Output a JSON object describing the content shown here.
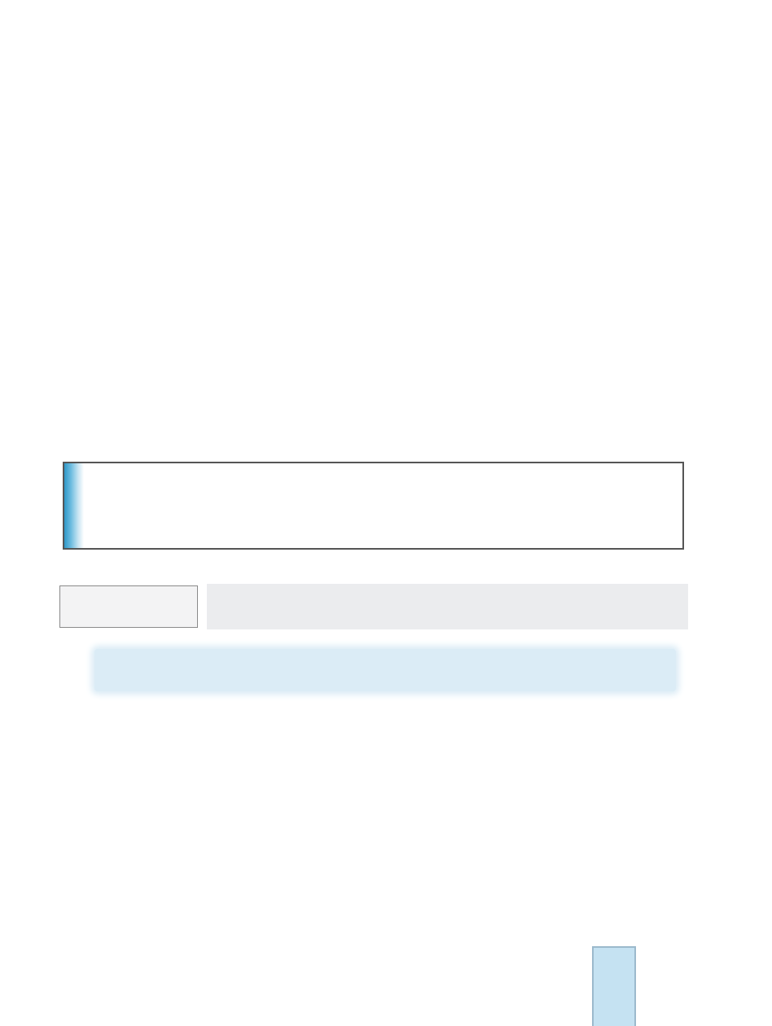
{
  "colors": {
    "callout_border": "#555555",
    "callout_accent": "#2f98c8",
    "label_box_fill": "#f3f3f4",
    "grey_band": "#ebecee",
    "blue_banner": "#dbecf6",
    "page_tab": "#c5e2f2"
  }
}
